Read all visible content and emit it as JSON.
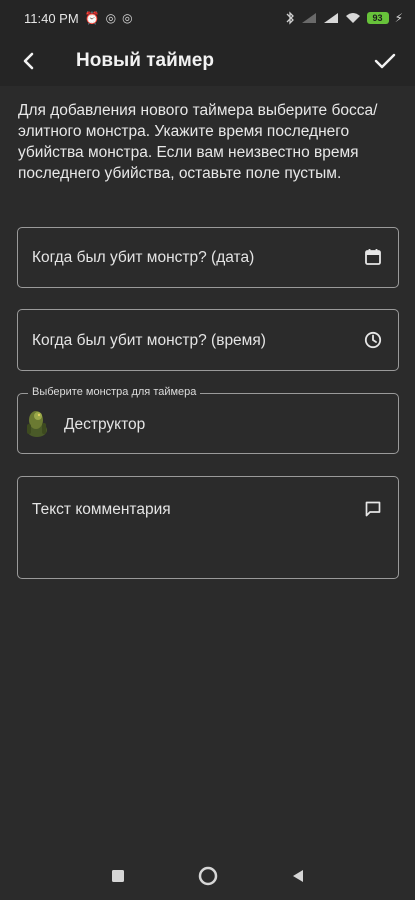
{
  "status_bar": {
    "time": "11:40 PM",
    "battery": "93"
  },
  "app_bar": {
    "title": "Новый таймер"
  },
  "description": "Для добавления нового таймера выберите босса/элитного монстра. Укажите время последнего убийства монстра. Если вам неизвестно время последнего убийства, оставьте поле пустым.",
  "form": {
    "kill_date_placeholder": "Когда был убит монстр? (дата)",
    "kill_time_placeholder": "Когда был убит монстр? (время)",
    "monster_label": "Выберите монстра для таймера",
    "monster_value": "Деструктор",
    "comment_placeholder": "Текст комментария"
  },
  "icons": {
    "back": "arrow-back-icon",
    "confirm": "check-icon",
    "date": "calendar-icon",
    "time": "clock-icon",
    "comment": "comment-icon"
  },
  "colors": {
    "background": "#2b2b2b",
    "bar": "#252525",
    "border": "#9a9a9a",
    "text": "#ececec",
    "battery": "#67c23a"
  }
}
